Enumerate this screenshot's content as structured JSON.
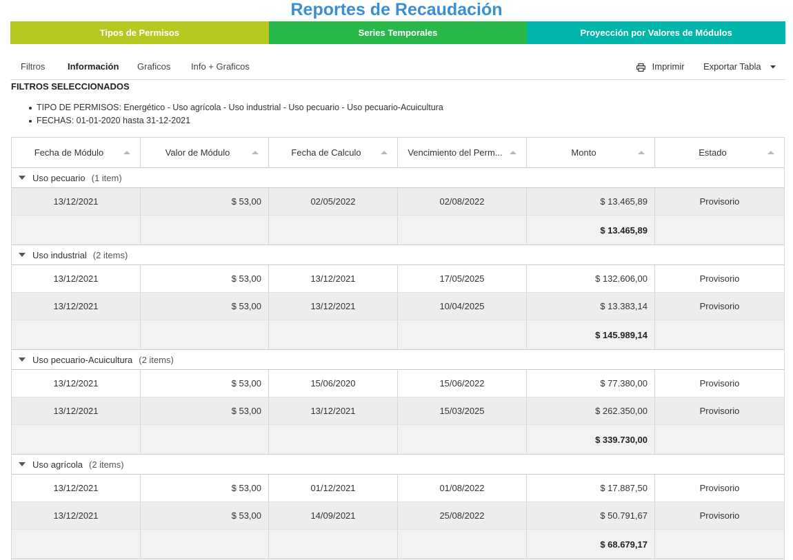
{
  "title": "Reportes de Recaudación",
  "top_tabs": [
    {
      "label": "Tipos de Permisos",
      "color": "#b5c81f"
    },
    {
      "label": "Series Temporales",
      "color": "#28b84a"
    },
    {
      "label": "Proyección por Valores de Módulos",
      "color": "#00b5aa"
    }
  ],
  "nav": {
    "tabs": [
      "Filtros",
      "Información",
      "Graficos",
      "Info + Graficos"
    ],
    "active": "Información",
    "print_label": "Imprimir",
    "print_icon": "printer-icon",
    "export_label": "Exportar Tabla",
    "export_icon": "caret-down-icon"
  },
  "filters": {
    "title": "FILTROS SELECCIONADOS",
    "items": [
      "TIPO DE PERMISOS: Energético - Uso agrícola - Uso industrial - Uso pecuario - Uso pecuario-Acuicultura",
      "FECHAS: 01-01-2020 hasta 31-12-2021"
    ]
  },
  "table": {
    "columns": [
      "Fecha de Módulo",
      "Valor de Módulo",
      "Fecha de Calculo",
      "Vencimiento del Perm...",
      "Monto",
      "Estado"
    ],
    "groups": [
      {
        "name": "Uso pecuario",
        "count": "(1 item)",
        "rows": [
          [
            "13/12/2021",
            "$ 53,00",
            "02/05/2022",
            "02/08/2022",
            "$ 13.465,89",
            "Provisorio"
          ]
        ],
        "total": "$ 13.465,89"
      },
      {
        "name": "Uso industrial",
        "count": "(2 items)",
        "rows": [
          [
            "13/12/2021",
            "$ 53,00",
            "13/12/2021",
            "17/05/2025",
            "$ 132.606,00",
            "Provisorio"
          ],
          [
            "13/12/2021",
            "$ 53,00",
            "13/12/2021",
            "10/04/2025",
            "$ 13.383,14",
            "Provisorio"
          ]
        ],
        "total": "$ 145.989,14"
      },
      {
        "name": "Uso pecuario-Acuicultura",
        "count": "(2 items)",
        "rows": [
          [
            "13/12/2021",
            "$ 53,00",
            "15/06/2020",
            "15/06/2022",
            "$ 77.380,00",
            "Provisorio"
          ],
          [
            "13/12/2021",
            "$ 53,00",
            "13/12/2021",
            "15/03/2025",
            "$ 262.350,00",
            "Provisorio"
          ]
        ],
        "total": "$ 339.730,00"
      },
      {
        "name": "Uso agrícola",
        "count": "(2 items)",
        "rows": [
          [
            "13/12/2021",
            "$ 53,00",
            "01/12/2021",
            "01/08/2022",
            "$ 17.887,50",
            "Provisorio"
          ],
          [
            "13/12/2021",
            "$ 53,00",
            "14/09/2021",
            "25/08/2022",
            "$ 50.791,67",
            "Provisorio"
          ]
        ],
        "total": "$ 68.679,17"
      }
    ]
  }
}
